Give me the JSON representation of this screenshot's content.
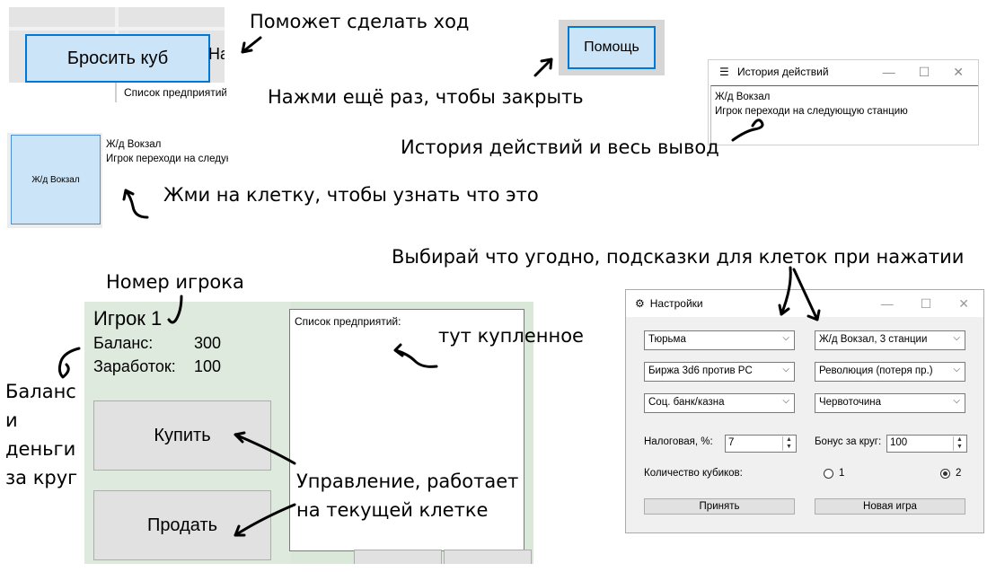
{
  "annotations": {
    "help_move": "Поможет сделать ход",
    "press_again": "Нажми ещё раз, чтобы закрыть",
    "history": "История действий и весь вывод",
    "cell_hint": "Жми на клетку, чтобы узнать что это",
    "choose": "Выбирай что угодно, подсказки для клеток при нажатии",
    "player_number": "Номер игрока",
    "bought": "тут купленное",
    "balance_line1": "Баланс",
    "balance_line2": "и",
    "balance_line3": "деньги",
    "balance_line4": "за круг",
    "control_line1": "Управление, работает",
    "control_line2": "на текущей клетке"
  },
  "dice_panel": {
    "roll_button": "Бросить куб",
    "cut_text": "На",
    "enterprises_label": "Список предприятий"
  },
  "help_panel": {
    "help_button": "Помощь"
  },
  "history_window": {
    "title": "История действий",
    "lines": [
      "Ж/д Вокзал",
      "Игрок переходи на следующую станцию"
    ]
  },
  "cell_panel": {
    "cell_label": "Ж/д Вокзал",
    "lines": [
      "Ж/д Вокзал",
      "Игрок переходи на следующую станцию"
    ]
  },
  "player_panel": {
    "player_name": "Игрок 1",
    "balance_label": "Баланс:",
    "balance_value": "300",
    "earnings_label": "Заработок:",
    "earnings_value": "100",
    "buy_button": "Купить",
    "sell_button": "Продать",
    "enterprises_list_label": "Список предприятий:"
  },
  "settings_window": {
    "title": "Настройки",
    "combos": [
      "Тюрьма",
      "Ж/д Вокзал, 3 станции",
      "Биржа 3d6 против PC",
      "Революция (потеря пр.)",
      "Соц. банк/казна",
      "Червоточина"
    ],
    "tax_label": "Налоговая, %:",
    "tax_value": "7",
    "bonus_label": "Бонус за круг:",
    "bonus_value": "100",
    "dice_count_label": "Количество кубиков:",
    "dice_options": [
      "1",
      "2"
    ],
    "dice_selected": "2",
    "accept_button": "Принять",
    "new_game_button": "Новая игра"
  }
}
